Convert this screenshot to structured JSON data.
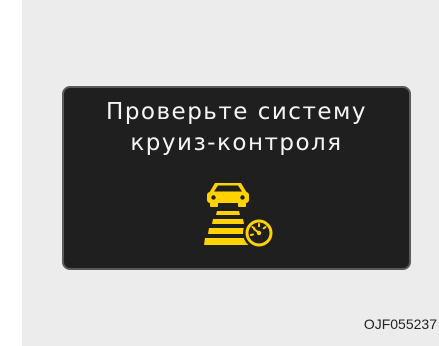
{
  "display": {
    "line1": "Проверьте систему",
    "line2": "круиз-контроля",
    "icon": "cruise-control-warning-icon",
    "background_color": "#1f1f1f",
    "text_color": "#f4f4f4",
    "icon_color": "#ffd200"
  },
  "figure_code": "OJF055237",
  "colors": {
    "page_background": "#ececec",
    "display_border": "#5a5a5a"
  }
}
